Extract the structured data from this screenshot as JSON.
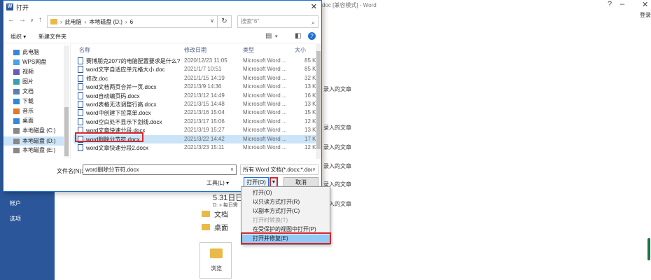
{
  "word": {
    "title_fragment": "doc [兼容模式] - Word",
    "login": "登录",
    "sidebar_items": [
      "帐户",
      "选项"
    ],
    "recent_suffix": "录入的文章",
    "recent_title": "5.31日已",
    "recent_path": "D: » 每日需",
    "folder_docs": "文档",
    "folder_desktop": "桌面",
    "browse_label": "浏览"
  },
  "dialog": {
    "title": "打开",
    "address": {
      "parts": [
        "此电脑",
        "本地磁盘 (D:)",
        "6"
      ]
    },
    "search_placeholder": "搜索\"6\"",
    "toolbar": {
      "organize": "组织 ▾",
      "new_folder": "新建文件夹"
    },
    "nav_items": [
      {
        "label": "此电脑",
        "icon": "pc-icon"
      },
      {
        "label": "WPS网盘",
        "icon": "cloud-icon"
      },
      {
        "label": "视频",
        "icon": "video-icon"
      },
      {
        "label": "图片",
        "icon": "image-icon"
      },
      {
        "label": "文档",
        "icon": "document-icon"
      },
      {
        "label": "下载",
        "icon": "download-icon"
      },
      {
        "label": "音乐",
        "icon": "music-icon"
      },
      {
        "label": "桌面",
        "icon": "desktop-icon"
      },
      {
        "label": "本地磁盘 (C:)",
        "icon": "drive-icon"
      },
      {
        "label": "本地磁盘 (D:)",
        "icon": "drive-icon"
      },
      {
        "label": "本地磁盘 (E:)",
        "icon": "drive-icon"
      }
    ],
    "columns": {
      "name": "名称",
      "date": "修改日期",
      "type": "类型",
      "size": "大小"
    },
    "files": [
      {
        "name": "赛博朋克2077的电脑配置要求是什么?...",
        "date": "2020/12/23 11:05",
        "type": "Microsoft Word ...",
        "size": "85 KB"
      },
      {
        "name": "word文字自适应单元格大小.doc",
        "date": "2021/1/7 10:51",
        "type": "Microsoft Word ...",
        "size": "85 KB"
      },
      {
        "name": "修改.doc",
        "date": "2021/1/15 14:19",
        "type": "Microsoft Word ...",
        "size": "32 KB"
      },
      {
        "name": "word文档两页合并一页.docx",
        "date": "2021/3/9 14:36",
        "type": "Microsoft Word ...",
        "size": "13 KB"
      },
      {
        "name": "word自动编页码.docx",
        "date": "2021/3/12 14:49",
        "type": "Microsoft Word ...",
        "size": "16 KB"
      },
      {
        "name": "word表格无法调整行高.docx",
        "date": "2021/3/15 14:48",
        "type": "Microsoft Word ...",
        "size": "13 KB"
      },
      {
        "name": "word中创建下拉菜单.docx",
        "date": "2021/3/16 15:04",
        "type": "Microsoft Word ...",
        "size": "15 KB"
      },
      {
        "name": "word空白处不显示下划线.docx",
        "date": "2021/3/17 15:06",
        "type": "Microsoft Word ...",
        "size": "12 KB"
      },
      {
        "name": "word文章快速分段.docx",
        "date": "2021/3/19 15:27",
        "type": "Microsoft Word ...",
        "size": "13 KB"
      },
      {
        "name": "word删除分节符.docx",
        "date": "2021/3/22 14:42",
        "type": "Microsoft Word ...",
        "size": "17 KB"
      },
      {
        "name": "word文章快速分段2.docx",
        "date": "2021/3/23 15:11",
        "type": "Microsoft Word ...",
        "size": "12 KB"
      }
    ],
    "selected_index": 9,
    "filename_label": "文件名(N):",
    "filename_value": "word删除分节符.docx",
    "filetype_value": "所有 Word 文档(*.docx;*.doc",
    "tools_label": "工具(L)  ▾",
    "open_label": "打开(O)",
    "cancel_label": "取消"
  },
  "open_menu": [
    {
      "label": "打开(O)",
      "disabled": false
    },
    {
      "label": "以只读方式打开(R)",
      "disabled": false
    },
    {
      "label": "以副本方式打开(C)",
      "disabled": false
    },
    {
      "label": "打开时转换(T)",
      "disabled": true
    },
    {
      "label": "在受保护的视图中打开(P)",
      "disabled": false
    },
    {
      "label": "打开并修复(E)",
      "disabled": false,
      "highlighted": true
    }
  ],
  "colors": {
    "word_blue": "#2b579a",
    "highlight_red": "#d9262c",
    "selection": "#cce4f7"
  }
}
